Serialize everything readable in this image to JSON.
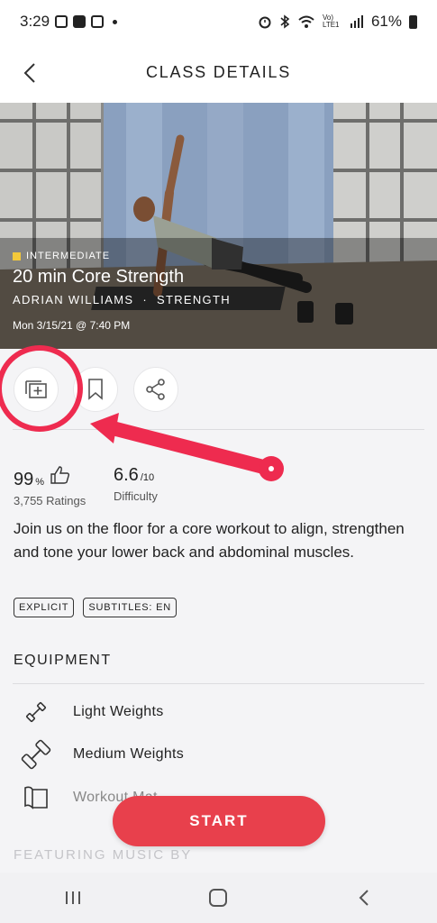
{
  "status_bar": {
    "time": "3:29",
    "network": "Vo) LTE1",
    "battery": "61%"
  },
  "header": {
    "title": "CLASS DETAILS"
  },
  "hero": {
    "level": "INTERMEDIATE",
    "title": "20 min Core Strength",
    "instructor": "ADRIAN WILLIAMS",
    "separator": "·",
    "category": "STRENGTH",
    "date": "Mon 3/15/21 @ 7:40 PM"
  },
  "actions": {
    "icons": [
      "add-to-stack-icon",
      "bookmark-icon",
      "share-icon"
    ]
  },
  "stats": {
    "rating": {
      "value": "99",
      "unit": "%",
      "sub": "3,755 Ratings"
    },
    "difficulty": {
      "value": "6.6",
      "unit": "/10",
      "sub": "Difficulty"
    }
  },
  "description": "Join us on the floor for a core workout to align, strengthen and tone your lower back and abdominal muscles.",
  "tags": [
    "EXPLICIT",
    "SUBTITLES: EN"
  ],
  "equipment": {
    "title": "EQUIPMENT",
    "items": [
      "Light Weights",
      "Medium Weights",
      "Workout Mat"
    ]
  },
  "start_button": "START",
  "music_title": "FEATURING MUSIC BY",
  "colors": {
    "accent": "#e8404c",
    "annotation": "#ee2b4f",
    "level": "#f3c83a"
  }
}
